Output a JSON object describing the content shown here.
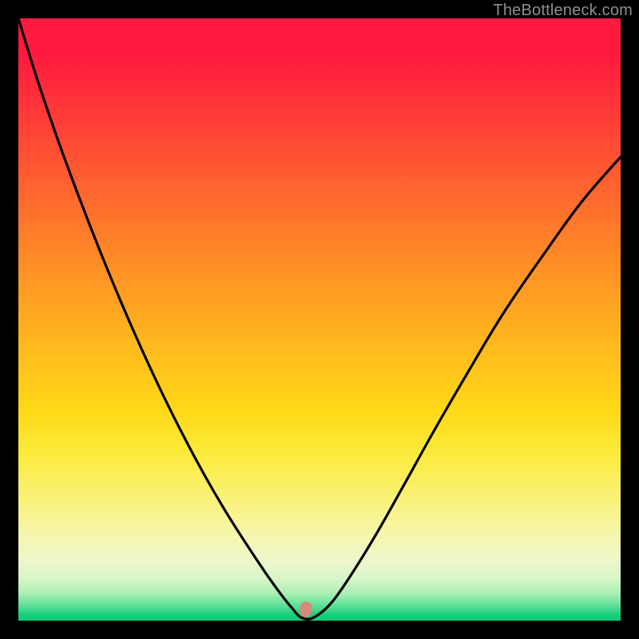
{
  "watermark": "TheBottleneck.com",
  "marker": {
    "x_frac": 0.478,
    "y_frac": 0.982,
    "color": "#d38b7a"
  },
  "chart_data": {
    "type": "line",
    "title": "",
    "xlabel": "",
    "ylabel": "",
    "xlim": [
      0,
      1
    ],
    "ylim": [
      0,
      1
    ],
    "grid": false,
    "legend": false,
    "annotations": [
      "TheBottleneck.com"
    ],
    "series": [
      {
        "name": "curve",
        "x": [
          0.0,
          0.03,
          0.065,
          0.1,
          0.135,
          0.17,
          0.205,
          0.24,
          0.275,
          0.31,
          0.345,
          0.38,
          0.41,
          0.435,
          0.455,
          0.47,
          0.49,
          0.52,
          0.555,
          0.595,
          0.64,
          0.69,
          0.745,
          0.805,
          0.87,
          0.935,
          1.0
        ],
        "y": [
          1.0,
          0.903,
          0.8,
          0.705,
          0.615,
          0.53,
          0.45,
          0.375,
          0.305,
          0.24,
          0.18,
          0.125,
          0.08,
          0.045,
          0.02,
          0.005,
          0.005,
          0.03,
          0.08,
          0.145,
          0.225,
          0.315,
          0.41,
          0.51,
          0.605,
          0.695,
          0.77
        ]
      }
    ],
    "marker_point": {
      "x": 0.478,
      "y": 0.015
    }
  }
}
